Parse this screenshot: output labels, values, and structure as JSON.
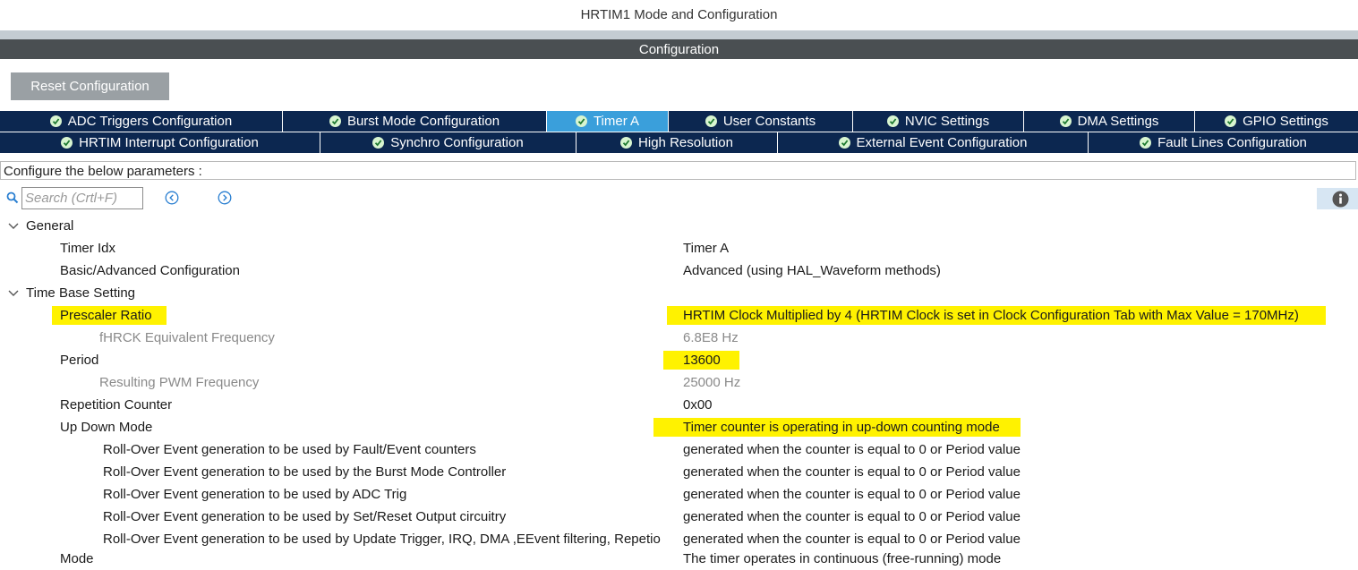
{
  "window": {
    "title": "HRTIM1 Mode and Configuration"
  },
  "config_bar": {
    "label": "Configuration"
  },
  "reset_button": {
    "label": "Reset Configuration"
  },
  "tabs_row1": [
    {
      "label": "ADC Triggers Configuration"
    },
    {
      "label": "Burst Mode Configuration"
    },
    {
      "label": "Timer A"
    },
    {
      "label": "User Constants"
    },
    {
      "label": "NVIC Settings"
    },
    {
      "label": "DMA Settings"
    },
    {
      "label": "GPIO Settings"
    }
  ],
  "tabs_row2": [
    {
      "label": "HRTIM Interrupt Configuration"
    },
    {
      "label": "Synchro Configuration"
    },
    {
      "label": "High Resolution"
    },
    {
      "label": "External Event Configuration"
    },
    {
      "label": "Fault Lines Configuration"
    }
  ],
  "active_tab": "Timer A",
  "param_hint": "Configure the below parameters :",
  "search": {
    "placeholder": "Search (Crtl+F)",
    "value": ""
  },
  "colors": {
    "tab_bg": "#0c2750",
    "tab_active": "#3a9fdb",
    "highlight": "#fff200",
    "config_bar": "#4a4f52"
  },
  "tree": {
    "general": {
      "label": "General",
      "timer_idx": {
        "name": "Timer Idx",
        "value": "Timer A"
      },
      "basic_adv": {
        "name": "Basic/Advanced Configuration",
        "value": "Advanced (using HAL_Waveform methods)"
      }
    },
    "time_base": {
      "label": "Time Base Setting",
      "prescaler": {
        "name": "Prescaler Ratio",
        "value": "HRTIM Clock Multiplied by 4 (HRTIM Clock is set in Clock Configuration Tab with Max Value = 170MHz)"
      },
      "fhrck": {
        "name": "fHRCK Equivalent Frequency",
        "value": "6.8E8 Hz"
      },
      "period": {
        "name": "Period",
        "value": "13600"
      },
      "pwm_freq": {
        "name": "Resulting PWM Frequency",
        "value": "25000 Hz"
      },
      "repetition": {
        "name": "Repetition Counter",
        "value": "0x00"
      },
      "updown": {
        "name": "Up Down Mode",
        "value": "Timer counter is operating in up-down counting mode"
      },
      "rollover_fault": {
        "name": "Roll-Over Event generation to be used by Fault/Event counters",
        "value": "generated when the counter is equal to 0 or Period value"
      },
      "rollover_burst": {
        "name": "Roll-Over Event generation to be used by the Burst Mode Controller",
        "value": "generated when the counter is equal to 0 or Period value"
      },
      "rollover_adc": {
        "name": "Roll-Over Event generation to be used by  ADC Trig",
        "value": "generated when the counter is equal to 0 or Period value"
      },
      "rollover_setreset": {
        "name": "Roll-Over Event generation to be used by Set/Reset Output circuitry",
        "value": "generated when the counter is equal to 0 or Period value"
      },
      "rollover_update": {
        "name": "Roll-Over Event generation to be used by Update Trigger, IRQ, DMA ,EEvent filtering, Repetio",
        "value": "generated when the counter is equal to 0 or Period value"
      },
      "mode": {
        "name": "Mode",
        "value": "The timer operates in continuous (free-running) mode"
      }
    }
  }
}
